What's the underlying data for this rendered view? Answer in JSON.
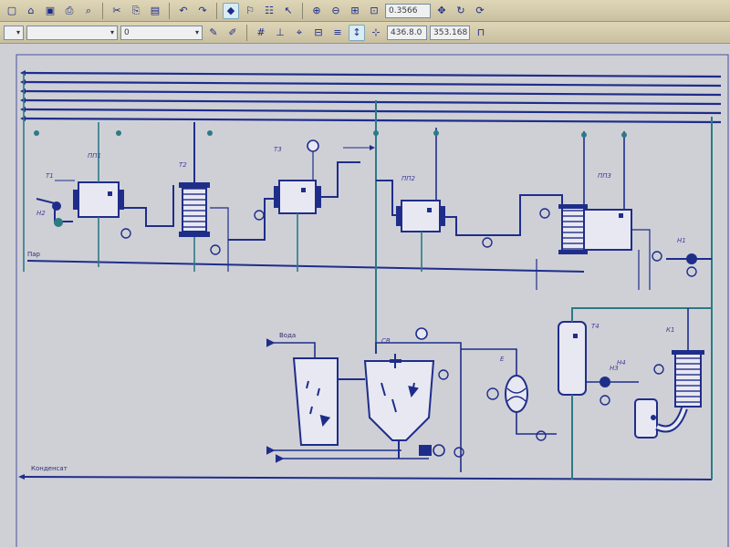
{
  "toolbar": {
    "zoom_value": "0.3566",
    "layer_value": "0",
    "coord_x": "436.8.0",
    "coord_y": "353.168"
  },
  "diagram": {
    "line_left_top": "Пар",
    "line_left_bottom": "Конденсат",
    "tank_label": "Вода",
    "tags": [
      "Т1",
      "ПП1",
      "Т2",
      "Т3",
      "ПП2",
      "ПП3",
      "Н1",
      "Н2",
      "СВ",
      "Е",
      "Т4",
      "Н3",
      "К1",
      "Н4"
    ]
  },
  "colors": {
    "line_primary": "#1f2d8a",
    "line_secondary": "#2c7a86",
    "tank_fill": "#e8e8f2",
    "background": "#cfd0d6"
  }
}
